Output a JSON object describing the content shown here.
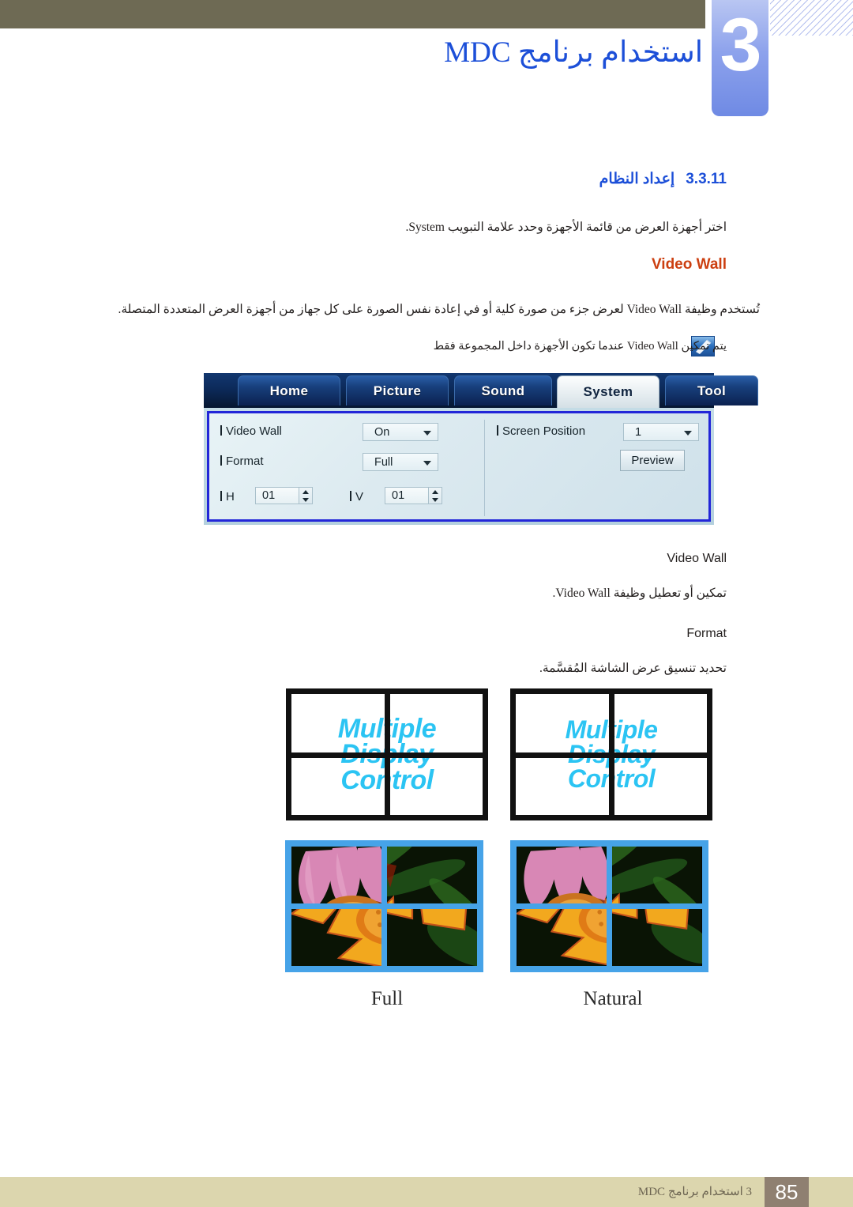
{
  "header": {
    "chapter_number": "3",
    "chapter_title": "استخدام برنامج MDC"
  },
  "section": {
    "number": "3.3.11",
    "title": "إعداد النظام",
    "intro": "اختر أجهزة العرض من قائمة الأجهزة وحدد علامة التبويب System.",
    "subheading": "Video Wall",
    "main_paragraph": "تُستخدم وظيفة Video Wall لعرض جزء من صورة كلية أو في إعادة نفس الصورة على كل جهاز من أجهزة العرض المتعددة المتصلة.",
    "note": "يتم تمكين Video Wall عندما تكون الأجهزة داخل المجموعة فقط",
    "note_icon": "note-pencil-icon"
  },
  "mdc_panel": {
    "tabs": [
      {
        "label": "Home",
        "active": false
      },
      {
        "label": "Picture",
        "active": false
      },
      {
        "label": "Sound",
        "active": false
      },
      {
        "label": "System",
        "active": true
      },
      {
        "label": "Tool",
        "active": false
      }
    ],
    "controls": {
      "video_wall_label": "Video Wall",
      "video_wall_value": "On",
      "format_label": "Format",
      "format_value": "Full",
      "h_label": "H",
      "h_value": "01",
      "v_label": "V",
      "v_value": "01",
      "screen_position_label": "Screen Position",
      "screen_position_value": "1",
      "preview_button": "Preview"
    }
  },
  "descriptions": [
    {
      "term": "Video Wall",
      "body": "تمكين أو تعطيل وظيفة Video Wall."
    },
    {
      "term": "Format",
      "body": "تحديد تنسيق عرض الشاشة المُقسَّمة."
    }
  ],
  "diagrams": {
    "wall_text_lines": [
      "Multiple",
      "Display",
      "Control"
    ],
    "captions": [
      "Full",
      "Natural"
    ],
    "grid": "2x2"
  },
  "footer": {
    "page_number": "85",
    "text": "3 استخدام برنامج MDC"
  },
  "colors": {
    "header_band": "#6e6a54",
    "chapter_blue": "#1c4fd8",
    "accent_orange": "#cc3f10",
    "wall_text_cyan": "#2bc4f3",
    "photo_border_blue": "#46a3e8",
    "footer_bar": "#dcd6ae",
    "footer_page_box": "#8f8071"
  }
}
